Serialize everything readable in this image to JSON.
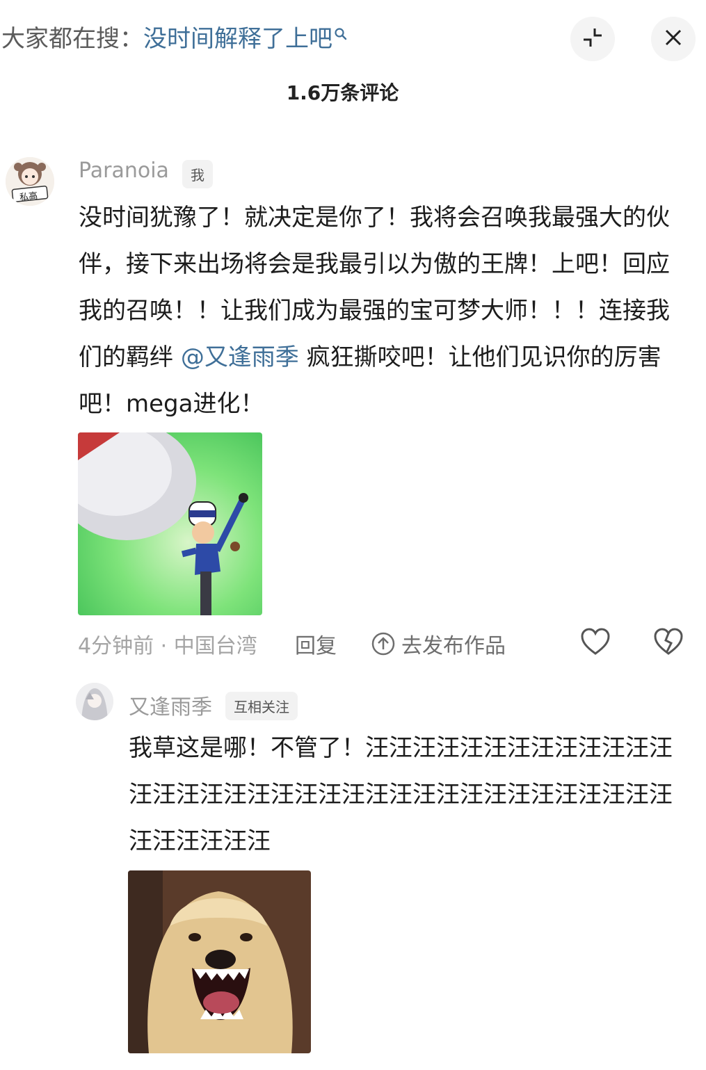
{
  "header": {
    "search_prefix": "大家都在搜：",
    "search_keyword": "没时间解释了上吧",
    "comment_count": "1.6万条评论"
  },
  "comments": [
    {
      "username": "Paranoia",
      "badge": "我",
      "text_before": "没时间犹豫了！就决定是你了！我将会召唤我最强大的伙伴，接下来出场将会是我最引以为傲的王牌！上吧！回应我的召唤！！让我们成为最强的宝可梦大师！！！连接我们的羁绊 ",
      "mention": "@又逢雨季",
      "text_after": " 疯狂撕咬吧！让他们见识你的厉害吧！mega进化！",
      "avatar_sign": "私高",
      "time_location": "4分钟前 · 中国台湾",
      "reply_label": "回复",
      "publish_label": "去发布作品"
    },
    {
      "username": "又逢雨季",
      "badge": "互相关注",
      "text": "我草这是哪！不管了！汪汪汪汪汪汪汪汪汪汪汪汪汪汪汪汪汪汪汪汪汪汪汪汪汪汪汪汪汪汪汪汪汪汪汪汪汪汪汪汪汪汪"
    }
  ],
  "icons": {
    "search": "magnifier-icon",
    "collapse": "collapse-icon",
    "close": "close-icon",
    "like": "heart-icon",
    "dislike": "broken-heart-icon",
    "publish": "upload-circle-icon"
  },
  "colors": {
    "link": "#3f6f98",
    "muted": "#9a9a9a",
    "text": "#1c1c1c"
  }
}
